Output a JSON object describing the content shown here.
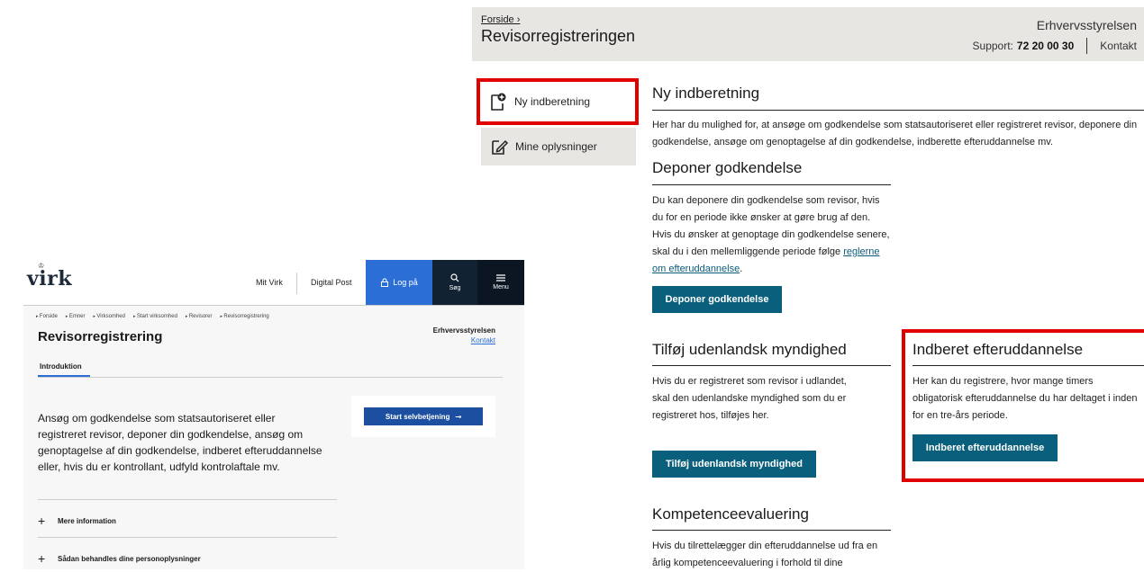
{
  "right": {
    "breadcrumb": "Forside ›",
    "title": "Revisorregistreringen",
    "org": "Erhvervsstyrelsen",
    "support_label": "Support:",
    "support_phone": "72 20 00 30",
    "contact": "Kontakt",
    "sidebar": [
      {
        "label": "Ny indberetning"
      },
      {
        "label": "Mine oplysninger"
      }
    ],
    "intro": {
      "heading": "Ny indberetning",
      "text": "Her har du mulighed for, at ansøge om godkendelse som statsautoriseret eller registreret revisor, deponere din godkendelse, ansøge om genoptagelse af din godkendelse, indberette efteruddannelse mv."
    },
    "deponer": {
      "heading": "Deponer godkendelse",
      "text": "Du kan deponere din godkendelse som revisor, hvis du for en periode ikke ønsker at gøre brug af den. Hvis du ønsker at genoptage din godkendelse senere, skal du i den mellemliggende periode følge",
      "link": "reglerne om efteruddannelse",
      "after_link": ".",
      "button": "Deponer godkendelse"
    },
    "tilfoej": {
      "heading": "Tilføj udenlandsk myndighed",
      "text": "Hvis du er registreret som revisor i udlandet, skal den udenlandske myndighed som du er registreret hos, tilføjes her.",
      "button": "Tilføj udenlandsk myndighed"
    },
    "indberet": {
      "heading": "Indberet efteruddannelse",
      "text": "Her kan du registrere, hvor mange timers obligatorisk efteruddannelse du har deltaget i inden for en tre-års periode.",
      "button": "Indberet efteruddannelse"
    },
    "kompetence": {
      "heading": "Kompetenceevaluering",
      "text": "Hvis du tilrettelægger din efteruddannelse ud fra en årlig kompetenceevaluering i forhold til dine"
    }
  },
  "left": {
    "logo": "virk",
    "nav": {
      "mit_virk": "Mit Virk",
      "digital_post": "Digital Post",
      "login": "Log på",
      "search": "Søg",
      "menu": "Menu"
    },
    "breadcrumbs": [
      "Forside",
      "Emner",
      "Virksomhed",
      "Start virksomhed",
      "Revisorer",
      "Revisorregistrering"
    ],
    "title": "Revisorregistrering",
    "org": "Erhvervsstyrelsen",
    "contact": "Kontakt",
    "tab": "Introduktion",
    "description": "Ansøg om godkendelse som statsautoriseret eller registreret revisor, deponer din godkendelse, ansøg om genoptagelse af din godkendelse, indberet efteruddannelse eller, hvis du er kontrollant, udfyld kontrolaftale mv.",
    "start_button": "Start selvbetjening",
    "expanders": [
      {
        "label": "Mere information"
      },
      {
        "label": "Sådan behandles dine personoplysninger"
      }
    ]
  },
  "colors": {
    "highlight": "#e10000",
    "button_teal": "#0a5f7c",
    "virk_blue": "#2b6fd6"
  }
}
